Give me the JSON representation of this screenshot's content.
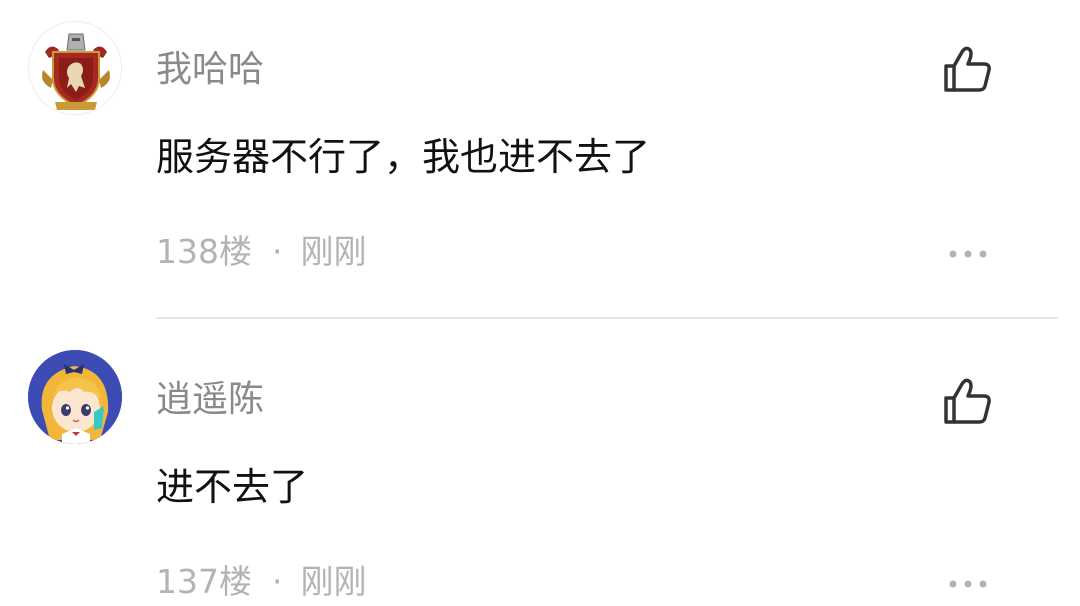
{
  "comments": [
    {
      "username": "我哈哈",
      "content": "服务器不行了，我也进不去了",
      "floor": "138楼",
      "separator": "·",
      "time": "刚刚",
      "avatar_icon": "house-crest-avatar",
      "like_icon": "thumbs-up-icon",
      "more_icon": "more-options-icon"
    },
    {
      "username": "逍遥陈",
      "content": "进不去了",
      "floor": "137楼",
      "separator": "·",
      "time": "刚刚",
      "avatar_icon": "anime-girl-avatar",
      "like_icon": "thumbs-up-icon",
      "more_icon": "more-options-icon"
    }
  ],
  "colors": {
    "username": "#8a8a8a",
    "content": "#111111",
    "meta": "#b3b3b3",
    "icon": "#333333",
    "divider": "#e6e6e6"
  }
}
